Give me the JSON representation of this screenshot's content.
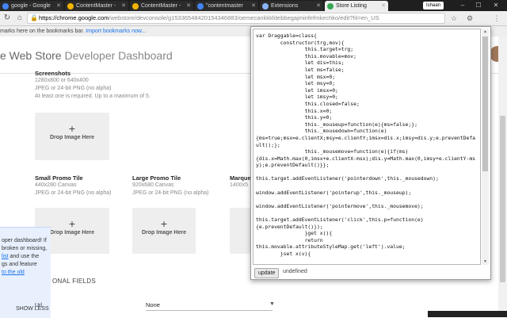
{
  "tabs": [
    {
      "label": "google - Google",
      "color": "#4285f4",
      "active": false
    },
    {
      "label": "ContentMaster -",
      "color": "#f4b400",
      "active": false
    },
    {
      "label": "ContentMaster -",
      "color": "#f4b400",
      "active": false
    },
    {
      "label": "\"contentmaster",
      "color": "#4285f4",
      "active": false
    },
    {
      "label": "Extensions",
      "color": "#8ab4f8",
      "active": false
    },
    {
      "label": "Store Listing",
      "color": "#34a853",
      "active": true
    }
  ],
  "window": {
    "user": "Ishaan"
  },
  "toolbar": {
    "url_host": "https://chrome.google.com",
    "url_path": "/webstore/devconsole/g15336548420154346883/oemecankkkfdebbegajminfefmkechko/edit?hl=en_US"
  },
  "bookmarks": {
    "text": "marks here on the bookmarks bar.",
    "link": "Import bookmarks now..."
  },
  "page": {
    "title_main": "e Web Store",
    "title_sub": "Developer Dashboard",
    "screenshots": {
      "title": "Screenshots",
      "line1": "1280x800 or 640x400",
      "line2": "JPEG or 24-bit PNG (no alpha)",
      "line3": "At least one is required. Up to a maximum of 5."
    },
    "drop_label": "Drop Image Here",
    "small_tile": {
      "title": "Small Promo Tile",
      "line1": "440x280 Canvas",
      "line2": "JPEG or 24-bit PNG (no alpha)"
    },
    "large_tile": {
      "title": "Large Promo Tile",
      "line1": "920x680 Canvas",
      "line2": "JPEG or 24-bit PNG (no alpha)"
    },
    "marquee": {
      "title": "Marque",
      "line1": "1400x5"
    },
    "notice": {
      "text1": "oper dashboard! If",
      "text2": "broken or missing,",
      "link1": "list",
      "text3": " and use the",
      "text4": "gs and feature",
      "link2": "to the old",
      "show_less": "SHOW LESS"
    },
    "optional_fields": "ONAL FIELDS",
    "url_field": {
      "label": "Url",
      "value": "None"
    }
  },
  "popup": {
    "code": "var Draggable=class{\n        constructor(trg,mov){\n                this.target=trg;\n                this.movable=mov;\n                let dis=this;\n                let ms=false;\n                let msx=0;\n                let msy=0;\n                let imsx=0;\n                let imsy=0;\n                this.closed=false;\n                this.x=0;\n                this.y=0;\n                this._mouseup=function(e){ms=false;};\n                this._mousedown=function(e)\n{ms=true;msx=e.clientX;msy=e.clientY;imsx=dis.x;imsy=dis.y;e.preventDefault();};\n                this._mousemove=function(e){if(ms)\n{dis.x=Math.max(0,imsx+e.clientX-msx);dis.y=Math.max(0,imsy+e.clientY-msy);e.preventDefault()}};\n\nthis.target.addEventListener('pointerdown',this._mousedown);\n\nwindow.addEventListener('pointerup',this._mouseup);\n\nwindow.addEventListener('pointermove',this._mousemove);\n\nthis.target.addEventListener('click',this.p=function(e)\n{e.preventDefault()});\n                }get x(){\n                return\nthis.movable.attributeStyleMap.get('left').value;\n        }set x(v){",
    "update_label": "update",
    "result": "undefined"
  }
}
